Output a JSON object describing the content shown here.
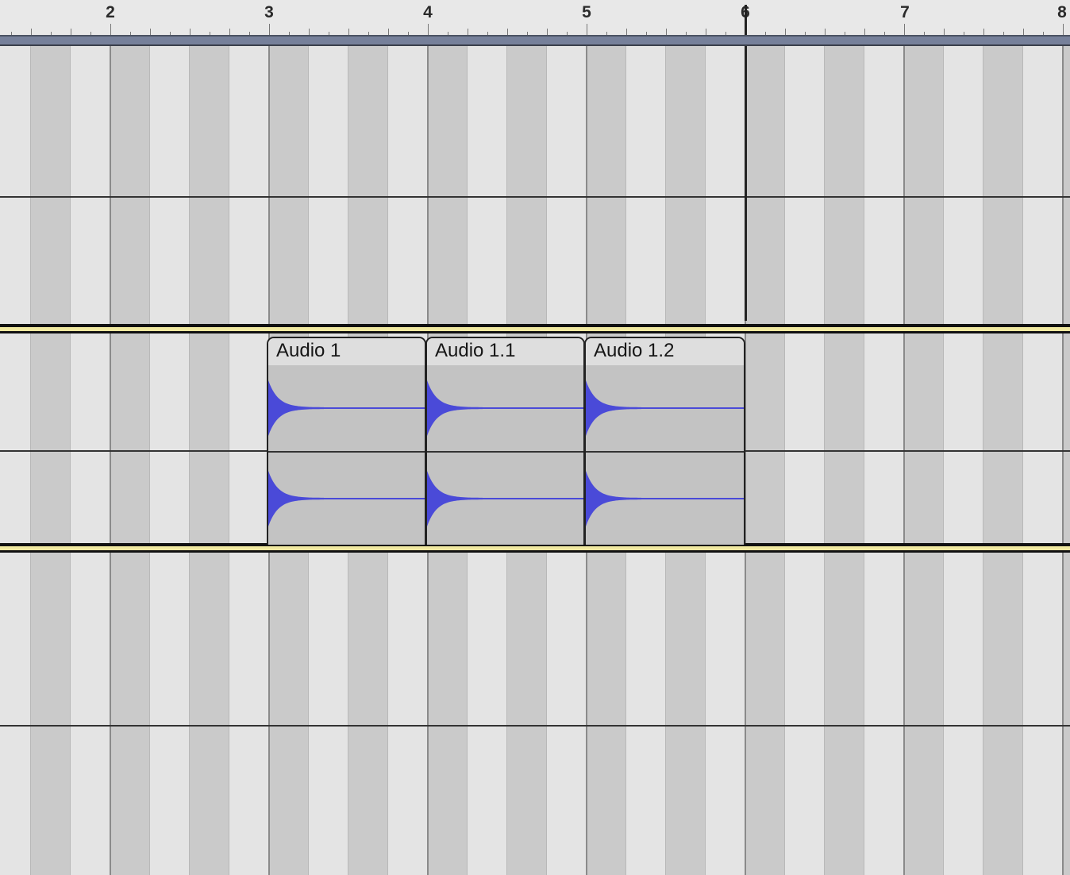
{
  "ruler": {
    "bars": [
      "2",
      "3",
      "4",
      "5",
      "6",
      "7",
      "8"
    ]
  },
  "tracks": {
    "selected_track_border_color": "#f0e8a0",
    "waveform_color": "#4a4ad8"
  },
  "clips": [
    {
      "name": "Audio 1"
    },
    {
      "name": "Audio 1.1"
    },
    {
      "name": "Audio 1.2"
    }
  ],
  "playhead": {
    "bar": "6"
  }
}
